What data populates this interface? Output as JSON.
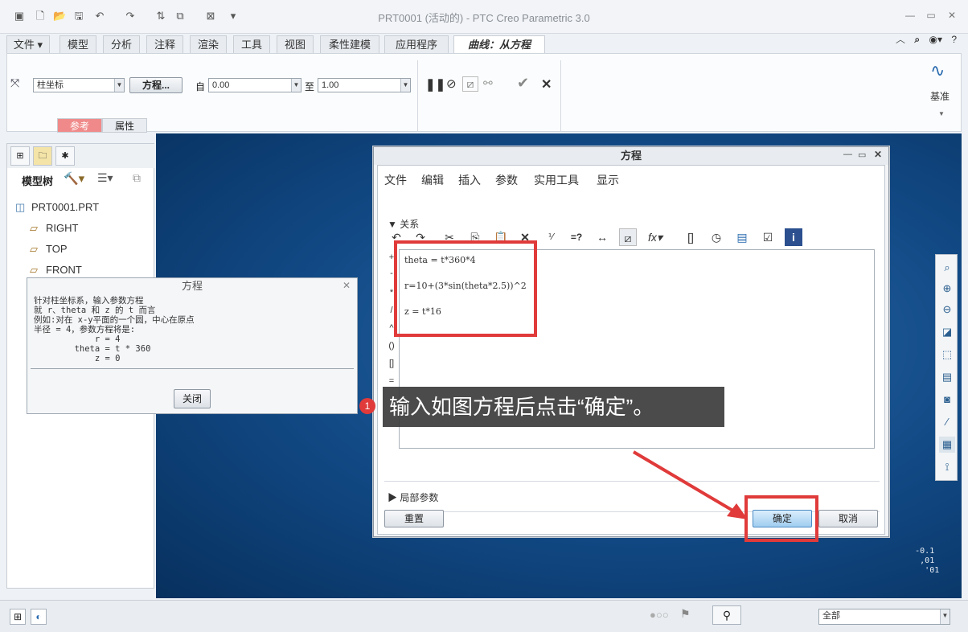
{
  "window": {
    "title": "PRT0001 (活动的) - PTC Creo Parametric 3.0",
    "quick_access_icons": [
      "app-icon",
      "new-icon",
      "open-icon",
      "save-icon",
      "undo-icon",
      "redo-icon",
      "regenerate-icon",
      "windows-icon",
      "close-window-icon",
      "customize-icon"
    ]
  },
  "ribbon_tabs": [
    {
      "label": "文件 ▾"
    },
    {
      "label": "模型"
    },
    {
      "label": "分析"
    },
    {
      "label": "注释"
    },
    {
      "label": "渲染"
    },
    {
      "label": "工具"
    },
    {
      "label": "视图"
    },
    {
      "label": "柔性建模"
    },
    {
      "label": "应用程序"
    },
    {
      "label": "曲线：从方程"
    }
  ],
  "ribbon": {
    "coord_type": "柱坐标",
    "equation_button": "方程...",
    "from_label": "自",
    "from_value": "0.00",
    "to_label": "至",
    "to_value": "1.00",
    "sub_tabs": [
      "参考",
      "属性"
    ],
    "datum_label": "基准"
  },
  "model_tree": {
    "header": "模型树",
    "items": [
      "PRT0001.PRT",
      "RIGHT",
      "TOP",
      "FRONT"
    ]
  },
  "help_popup": {
    "title": "方程",
    "body": "针对柱坐标系，输入参数方程\n就 r、theta 和 z 的 t 而言\n例如:对在 x-y平面的一个圆，中心在原点\n半径 = 4，参数方程将是:\n            r = 4\n        theta = t * 360\n            z = 0",
    "close_button": "关闭"
  },
  "equation_dialog": {
    "title": "方程",
    "menu": [
      "文件",
      "编辑",
      "插入",
      "参数",
      "实用工具",
      "显示"
    ],
    "section_label": "关系",
    "local_params_label": "局部参数",
    "lines": [
      "theta = t*360*4",
      "r=10+(3*sin(theta*2.5))^2",
      "z = t*16"
    ],
    "side_ops": [
      "+",
      "-",
      "*",
      "/",
      "^",
      "()",
      "[]",
      "="
    ],
    "reset_button": "重置",
    "ok_button": "确定",
    "cancel_button": "取消"
  },
  "annotation": {
    "number": "1",
    "text": "输入如图方程后点击“确定”。"
  },
  "statusbar": {
    "filter_value": "全部"
  },
  "colors": {
    "accent_red": "#e03a3a",
    "graphics_bg": "#124a86"
  }
}
